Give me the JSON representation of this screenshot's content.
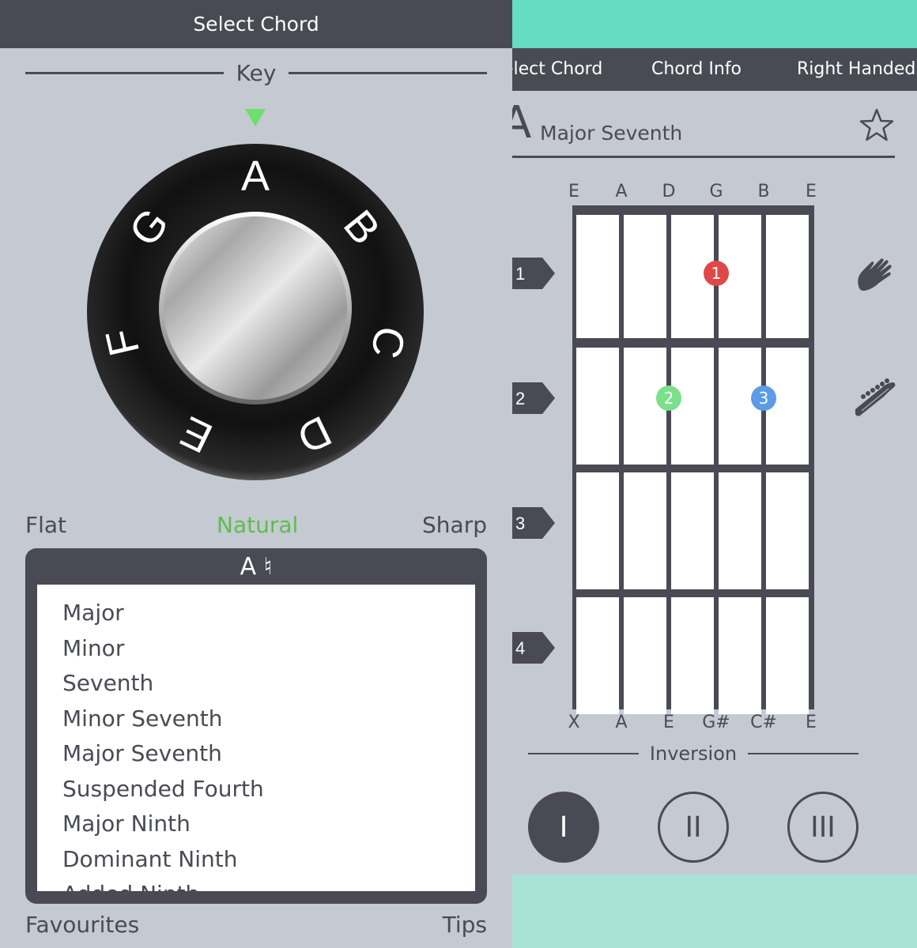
{
  "left": {
    "header_title": "Select Chord",
    "key_title": "Key",
    "dial_letters": [
      "A",
      "B",
      "C",
      "D",
      "E",
      "F",
      "G"
    ],
    "accidentals": {
      "flat": "Flat",
      "natural": "Natural",
      "sharp": "Sharp",
      "selected": "Natural"
    },
    "chord_box_title": "A ♮",
    "chord_types": [
      "Major",
      "Minor",
      "Seventh",
      "Minor Seventh",
      "Major Seventh",
      "Suspended Fourth",
      "Major Ninth",
      "Dominant Ninth",
      "Added Ninth"
    ],
    "footer": {
      "favourites": "Favourites",
      "tips": "Tips"
    }
  },
  "right": {
    "tabs": [
      "elect Chord",
      "Chord Info",
      "Right Handed"
    ],
    "chord_root": "A",
    "chord_name": "Major Seventh",
    "open_strings": [
      "E",
      "A",
      "D",
      "G",
      "B",
      "E"
    ],
    "played_notes": [
      "X",
      "A",
      "E",
      "G#",
      "C#",
      "E"
    ],
    "fret_numbers": [
      "1",
      "2",
      "3",
      "4"
    ],
    "fingers": [
      {
        "label": "1",
        "fret": 1,
        "string": 4,
        "color": "#e04848"
      },
      {
        "label": "2",
        "fret": 2,
        "string": 3,
        "color": "#7be08a"
      },
      {
        "label": "3",
        "fret": 2,
        "string": 5,
        "color": "#5c9be6"
      }
    ],
    "inversion_title": "Inversion",
    "inversions": [
      "I",
      "II",
      "III"
    ],
    "selected_inversion": "I"
  },
  "colors": {
    "dark": "#4a4a54",
    "background": "#c5c9d1",
    "mint_top": "#66dcc2",
    "mint_bottom": "#a9e3d6",
    "natural_green": "#5cbf4a",
    "pointer_green": "#6be06b"
  }
}
